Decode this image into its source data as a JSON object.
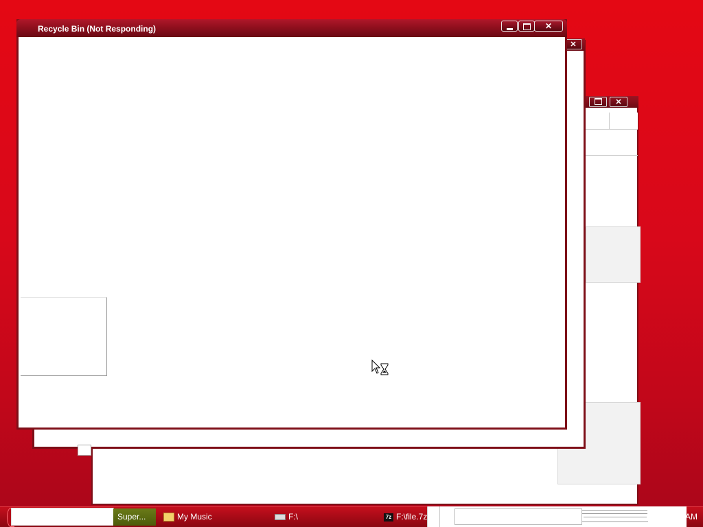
{
  "front_window": {
    "title": "Recycle Bin (Not Responding)",
    "buttons": {
      "minimize": "minimize-icon",
      "maximize": "maximize-icon",
      "close": "close-icon"
    }
  },
  "background_windows": [
    {
      "buttons": [
        "close-icon"
      ]
    },
    {
      "buttons": [
        "maximize-icon",
        "close-icon"
      ]
    }
  ],
  "cursor": {
    "state": "busy-hourglass-icon"
  },
  "taskbar": {
    "items": [
      {
        "label": "Super...",
        "icon": "app-icon",
        "active": true
      },
      {
        "label": "My Music",
        "icon": "folder-music-icon",
        "active": false
      },
      {
        "label": "F:\\",
        "icon": "drive-icon",
        "active": false
      },
      {
        "label": "F:\\file.7z",
        "icon": "7zip-icon",
        "active": false
      }
    ],
    "clock": "AM"
  },
  "colors": {
    "desktop": "#d8081a",
    "title_bar": "#8c0f1d",
    "border": "#7e0f18",
    "active_task": "#5a6a12"
  }
}
